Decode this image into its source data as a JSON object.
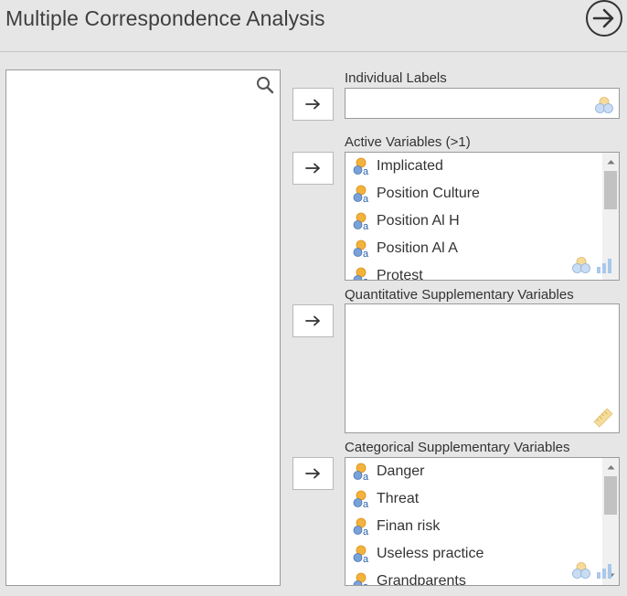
{
  "header": {
    "title": "Multiple Correspondence Analysis",
    "run_icon": "arrow-circle-right-icon"
  },
  "source": {
    "search_icon": "search-icon",
    "items": []
  },
  "move_button": {
    "glyph": "→"
  },
  "individual_labels": {
    "label": "Individual Labels",
    "type_icon": "nominal-type-icon"
  },
  "active_variables": {
    "label": "Active Variables (>1)",
    "items": [
      {
        "label": "Implicated",
        "icon": "nominal-variable-icon"
      },
      {
        "label": "Position Culture",
        "icon": "nominal-variable-icon"
      },
      {
        "label": "Position Al H",
        "icon": "nominal-variable-icon"
      },
      {
        "label": "Position Al A",
        "icon": "nominal-variable-icon"
      },
      {
        "label": "Protest",
        "icon": "nominal-variable-icon"
      }
    ],
    "type_icons": [
      "nominal-type-icon",
      "ordinal-type-icon"
    ]
  },
  "quantitative_supplementary": {
    "label": "Quantitative Supplementary Variables",
    "type_icon": "scale-ruler-icon",
    "items": []
  },
  "categorical_supplementary": {
    "label": "Categorical Supplementary Variables",
    "items": [
      {
        "label": "Danger",
        "icon": "nominal-variable-icon"
      },
      {
        "label": "Threat",
        "icon": "nominal-variable-icon"
      },
      {
        "label": "Finan risk",
        "icon": "nominal-variable-icon"
      },
      {
        "label": "Useless practice",
        "icon": "nominal-variable-icon"
      },
      {
        "label": "Grandparents",
        "icon": "nominal-variable-icon"
      }
    ],
    "type_icons": [
      "nominal-type-icon",
      "ordinal-type-icon"
    ]
  },
  "colors": {
    "background": "#e6e6e6",
    "panel": "#ffffff",
    "border": "#9a9a9a",
    "nominal_orange": "#f3b23b",
    "nominal_blue": "#5b87c7",
    "hint_blue": "#a9c8ea",
    "hint_yellow": "#f5dc9c"
  }
}
